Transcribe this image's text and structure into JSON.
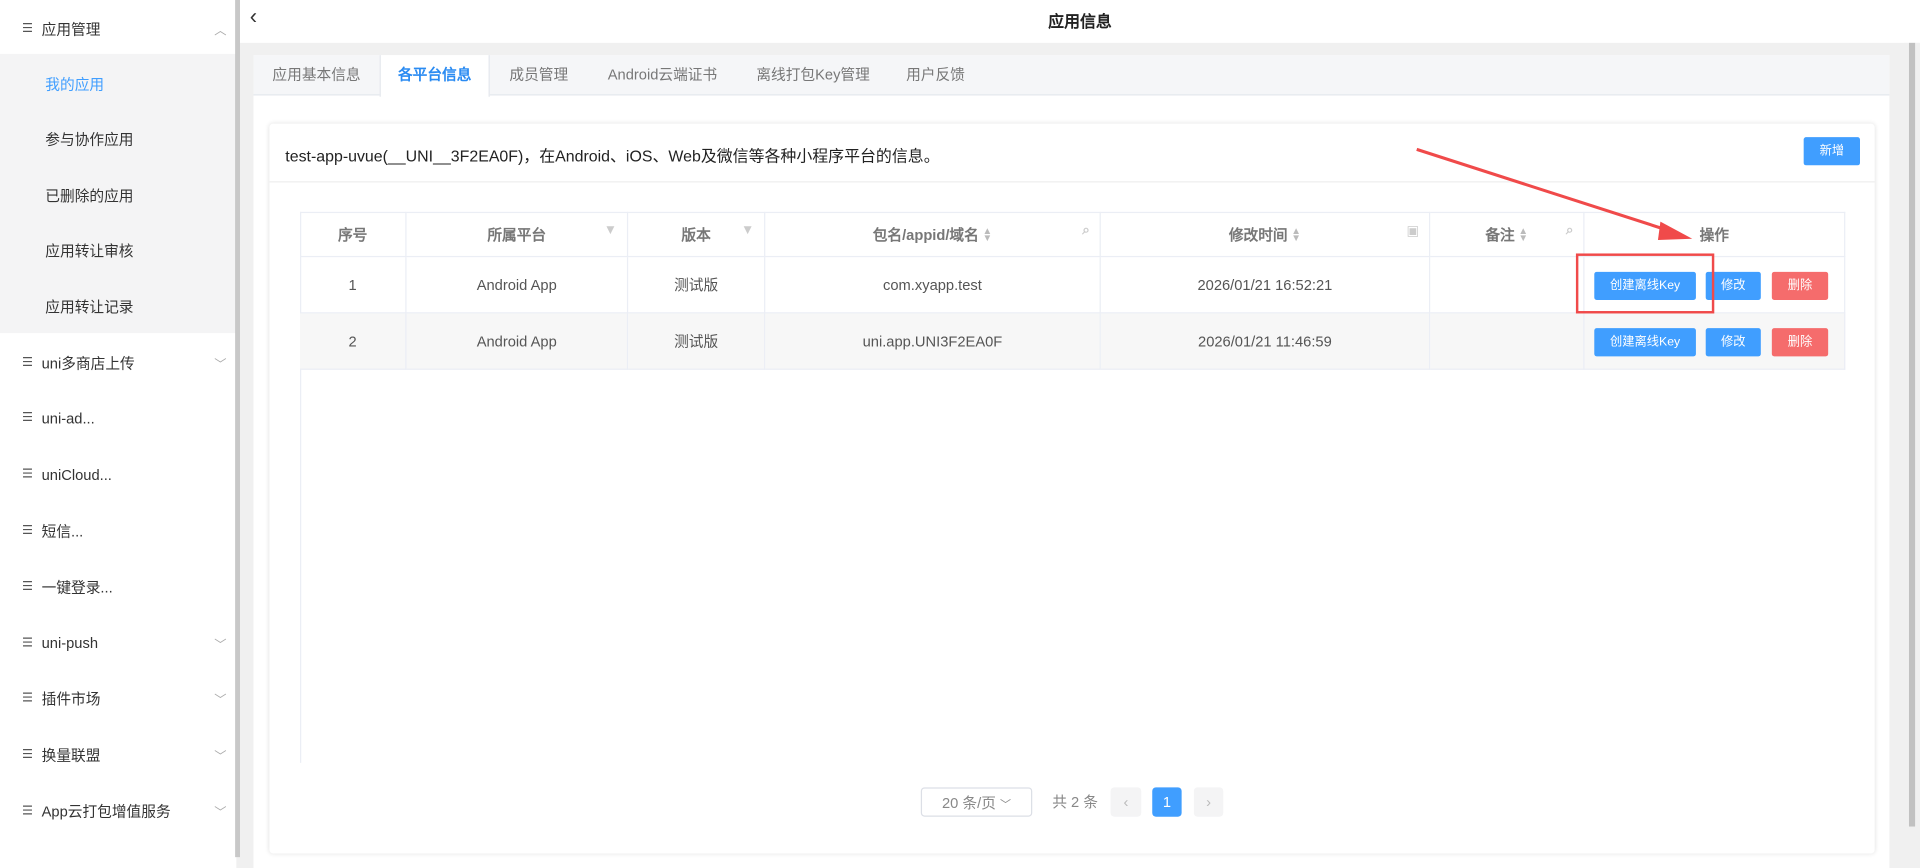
{
  "sidebar": {
    "group": {
      "label": "应用管理",
      "icon": "list-icon",
      "chevron": "chevron-up-icon"
    },
    "subitems": [
      {
        "label": "我的应用",
        "active": true
      },
      {
        "label": "参与协作应用"
      },
      {
        "label": "已删除的应用"
      },
      {
        "label": "应用转让审核"
      },
      {
        "label": "应用转让记录"
      }
    ],
    "items": [
      {
        "label": "uni多商店上传",
        "chevron": true
      },
      {
        "label": "uni-ad..."
      },
      {
        "label": "uniCloud..."
      },
      {
        "label": "短信..."
      },
      {
        "label": "一键登录..."
      },
      {
        "label": "uni-push",
        "chevron": true
      },
      {
        "label": "插件市场",
        "chevron": true
      },
      {
        "label": "换量联盟",
        "chevron": true
      },
      {
        "label": "App云打包增值服务",
        "chevron": true
      }
    ]
  },
  "header": {
    "title": "应用信息",
    "back_icon": "chevron-left-icon"
  },
  "tabs": [
    "应用基本信息",
    "各平台信息",
    "成员管理",
    "Android云端证书",
    "离线打包Key管理",
    "用户反馈"
  ],
  "active_tab": 1,
  "panel": {
    "title": "test-app-uvue(__UNI__3F2EA0F)，在Android、iOS、Web及微信等各种小程序平台的信息。",
    "add_label": "新增"
  },
  "table": {
    "columns": [
      "序号",
      "所属平台",
      "版本",
      "包名/appid/域名",
      "修改时间",
      "备注",
      "操作"
    ],
    "rows": [
      {
        "index": "1",
        "platform": "Android App",
        "version": "测试版",
        "package": "com.xyapp.test",
        "modified": "2026/01/21 16:52:21",
        "note": ""
      },
      {
        "index": "2",
        "platform": "Android App",
        "version": "测试版",
        "package": "uni.app.UNI3F2EA0F",
        "modified": "2026/01/21 11:46:59",
        "note": ""
      }
    ],
    "actions": {
      "create_key": "创建离线Key",
      "edit": "修改",
      "delete": "删除"
    }
  },
  "pagination": {
    "page_size": "20 条/页",
    "total": "共 2 条",
    "current": "1"
  },
  "colors": {
    "primary": "#409eff",
    "danger": "#f56c6c",
    "annotation": "#f04a4a"
  }
}
